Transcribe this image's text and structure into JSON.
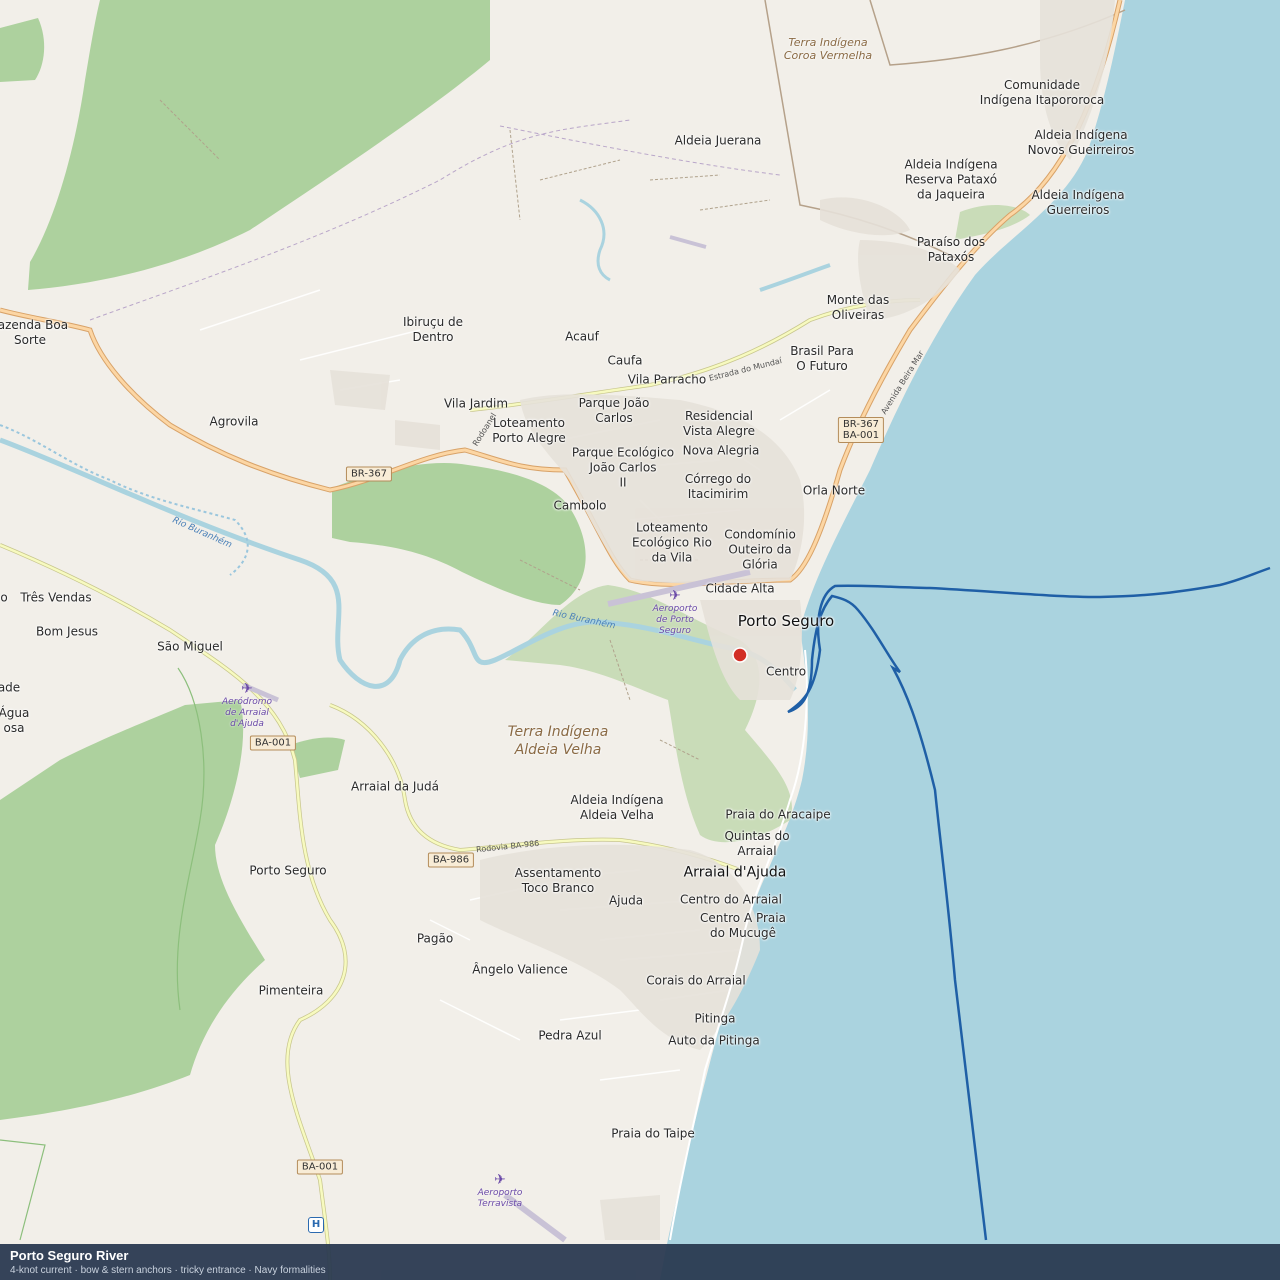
{
  "map": {
    "colors": {
      "land": "#f2efe9",
      "sea": "#aad3df",
      "forest": "#add19e",
      "wetland": "#c9dcb8",
      "primary_road": "#fcd6a4",
      "road_casing": "#d8a268",
      "secondary_road": "#f7fabf",
      "river": "#aad3df",
      "track": "#1f5fa6",
      "marker": "#d22e25",
      "boundary": "#b5a18a"
    },
    "places": [
      {
        "id": "coroa-vermelha",
        "label": "Terra Indígena\nCoroa Vermelha",
        "kind": "terra"
      },
      {
        "id": "itapororoca",
        "label": "Comunidade\nIndígena Itapororoca",
        "kind": "place"
      },
      {
        "id": "juerana",
        "label": "Aldeia Juerana",
        "kind": "place"
      },
      {
        "id": "novos-gueirreiros",
        "label": "Aldeia Indígena\nNovos Gueirreiros",
        "kind": "place"
      },
      {
        "id": "jaqueira",
        "label": "Aldeia Indígena\nReserva Pataxó\nda Jaqueira",
        "kind": "place"
      },
      {
        "id": "guerreiros",
        "label": "Aldeia Indígena\nGuerreiros",
        "kind": "place"
      },
      {
        "id": "paraiso",
        "label": "Paraíso dos\nPataxós",
        "kind": "place"
      },
      {
        "id": "monte-oliveiras",
        "label": "Monte das\nOliveiras",
        "kind": "place"
      },
      {
        "id": "fazenda-boa-sorte",
        "label": "Fazenda Boa\nSorte",
        "kind": "place"
      },
      {
        "id": "ibirucu",
        "label": "Ibiruçu de\nDentro",
        "kind": "place"
      },
      {
        "id": "acauf",
        "label": "Acauf",
        "kind": "place"
      },
      {
        "id": "caufa",
        "label": "Caufa",
        "kind": "place"
      },
      {
        "id": "brasil-futuro",
        "label": "Brasil Para\nO Futuro",
        "kind": "place"
      },
      {
        "id": "vila-parracho",
        "label": "Vila Parracho",
        "kind": "place"
      },
      {
        "id": "vila-jardim",
        "label": "Vila Jardim",
        "kind": "place"
      },
      {
        "id": "parque-joao-carlos",
        "label": "Parque João\nCarlos",
        "kind": "place"
      },
      {
        "id": "residencial-vista-alegre",
        "label": "Residencial\nVista Alegre",
        "kind": "place"
      },
      {
        "id": "agrovila",
        "label": "Agrovila",
        "kind": "place"
      },
      {
        "id": "loteamento-porto-alegre",
        "label": "Loteamento\nPorto Alegre",
        "kind": "place"
      },
      {
        "id": "parque-ecologico",
        "label": "Parque Ecológico\nJoão Carlos\nII",
        "kind": "place"
      },
      {
        "id": "nova-alegria",
        "label": "Nova Alegria",
        "kind": "place"
      },
      {
        "id": "corrego-itacimirim",
        "label": "Córrego do\nItacimirim",
        "kind": "place"
      },
      {
        "id": "orla-norte",
        "label": "Orla Norte",
        "kind": "place"
      },
      {
        "id": "cambolo",
        "label": "Cambolo",
        "kind": "place"
      },
      {
        "id": "loteamento-ecologico",
        "label": "Loteamento\nEcológico Rio\nda Vila",
        "kind": "place"
      },
      {
        "id": "condominio-outeiro",
        "label": "Condomínio\nOuteiro da\nGlória",
        "kind": "place"
      },
      {
        "id": "cidade-alta",
        "label": "Cidade Alta",
        "kind": "place"
      },
      {
        "id": "porto-seguro-city",
        "label": "Porto Seguro",
        "kind": "big"
      },
      {
        "id": "centro",
        "label": "Centro",
        "kind": "place"
      },
      {
        "id": "tres-vendas",
        "label": "Três Vendas",
        "kind": "place"
      },
      {
        "id": "bom-jesus",
        "label": "Bom Jesus",
        "kind": "place"
      },
      {
        "id": "sao-miguel",
        "label": "São Miguel",
        "kind": "place"
      },
      {
        "id": "edge-o",
        "label": "o",
        "kind": "place"
      },
      {
        "id": "edge-ade",
        "label": "ade",
        "kind": "place"
      },
      {
        "id": "edge-agua",
        "label": "Água\nosa",
        "kind": "place"
      },
      {
        "id": "aldeia-velha-terra",
        "label": "Terra Indígena\nAldeia Velha",
        "kind": "terra-large"
      },
      {
        "id": "arraial-juda",
        "label": "Arraial da Judá",
        "kind": "place"
      },
      {
        "id": "aldeia-velha",
        "label": "Aldeia Indígena\nAldeia Velha",
        "kind": "place"
      },
      {
        "id": "praia-aracaipe",
        "label": "Praia do Aracaipe",
        "kind": "place"
      },
      {
        "id": "quintas-arraial",
        "label": "Quintas do\nArraial",
        "kind": "place"
      },
      {
        "id": "arraial-dajuda",
        "label": "Arraial d'Ajuda",
        "kind": "city"
      },
      {
        "id": "porto-seguro-west",
        "label": "Porto Seguro",
        "kind": "place"
      },
      {
        "id": "assentamento",
        "label": "Assentamento\nToco Branco",
        "kind": "place"
      },
      {
        "id": "ajuda",
        "label": "Ajuda",
        "kind": "place"
      },
      {
        "id": "centro-arraial",
        "label": "Centro do Arraial",
        "kind": "place"
      },
      {
        "id": "centro-praia",
        "label": "Centro A Praia\ndo Mucugê",
        "kind": "place"
      },
      {
        "id": "pagao",
        "label": "Pagão",
        "kind": "place"
      },
      {
        "id": "angelo",
        "label": "Ângelo Valience",
        "kind": "place"
      },
      {
        "id": "pimenteira",
        "label": "Pimenteira",
        "kind": "place"
      },
      {
        "id": "corais",
        "label": "Corais do Arraial",
        "kind": "place"
      },
      {
        "id": "pitinga",
        "label": "Pitinga",
        "kind": "place"
      },
      {
        "id": "auto-pitinga",
        "label": "Auto da Pitinga",
        "kind": "place"
      },
      {
        "id": "pedra-azul",
        "label": "Pedra Azul",
        "kind": "place"
      },
      {
        "id": "praia-taipe",
        "label": "Praia do Taipe",
        "kind": "place"
      }
    ],
    "airports": [
      {
        "id": "aeroporto-porto-seguro",
        "label": "Aeroporto\nde Porto\nSeguro"
      },
      {
        "id": "aerodromo-arraial",
        "label": "Aeródromo\nde Arraial\nd'Ajuda"
      },
      {
        "id": "aeroporto-terravista",
        "label": "Aeroporto\nTerravista"
      }
    ],
    "shields": [
      {
        "id": "br367-west",
        "label": "BR-367"
      },
      {
        "id": "br367-ba001",
        "label": "BR-367\nBA-001"
      },
      {
        "id": "ba001-north",
        "label": "BA-001"
      },
      {
        "id": "ba986",
        "label": "BA-986"
      },
      {
        "id": "ba001-south",
        "label": "BA-001"
      }
    ],
    "road_labels": [
      {
        "id": "estrada-mundai",
        "label": "Estrada do Mundaí"
      },
      {
        "id": "rodoanel",
        "label": "Rodoanel"
      },
      {
        "id": "avenida-beira-mar",
        "label": "Avenida Beira Mar"
      },
      {
        "id": "rodovia-ba986",
        "label": "Rodovia BA-986"
      }
    ],
    "river_labels": [
      {
        "id": "rio-buranhem-west",
        "label": "Rio Buranhém"
      },
      {
        "id": "rio-buranhem-east",
        "label": "Rio Buranhém"
      }
    ]
  },
  "info": {
    "title": "Porto Seguro River",
    "details": "4-knot current · bow & stern anchors · tricky entrance · Navy formalities"
  }
}
